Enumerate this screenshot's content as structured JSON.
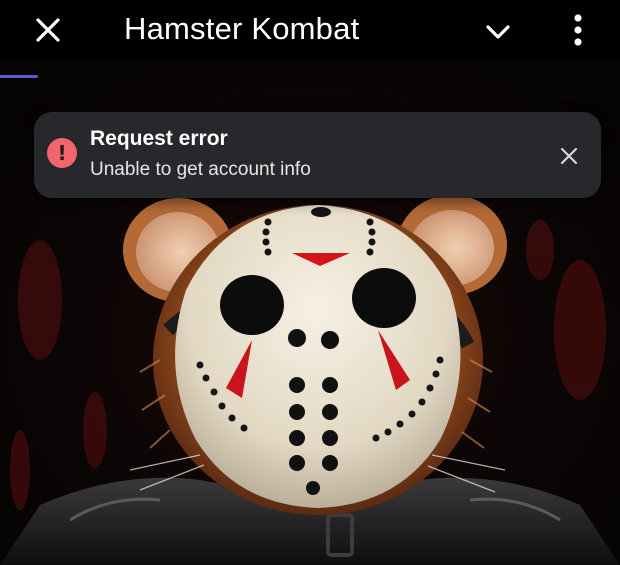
{
  "header": {
    "title": "Hamster Kombat",
    "close_icon": "close-icon",
    "chevron_icon": "chevron-down-icon",
    "menu_icon": "more-vertical-icon"
  },
  "toast": {
    "title": "Request error",
    "message": "Unable to get account info",
    "icon": "error-exclamation-icon",
    "close_icon": "close-icon",
    "accent_color": "#f4646c",
    "background_color": "#26282c"
  },
  "colors": {
    "background": "#000000",
    "loading_bar": "#5b5bd6",
    "text_primary": "#ffffff"
  }
}
